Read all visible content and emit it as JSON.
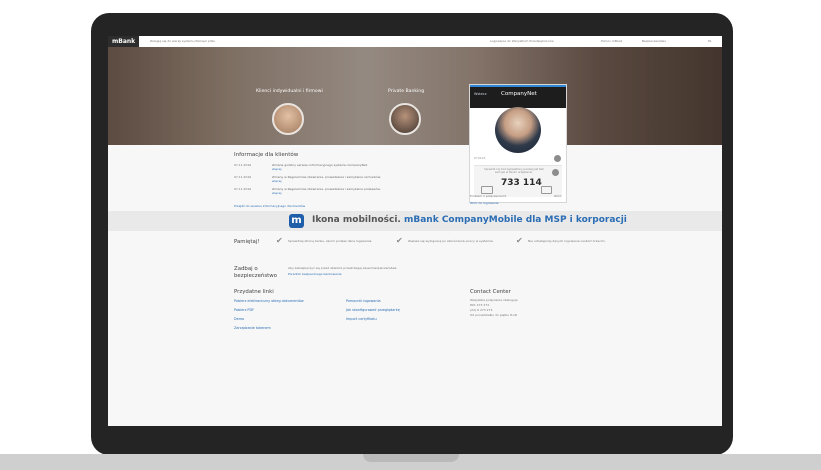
{
  "header": {
    "logo": "mBank",
    "notice": "Zaloguj się do wersji systemu Pamięci pliku",
    "right_links": [
      "Logowanie do Wszystkich Przedsiębiorców",
      "Pomoc mBank",
      "Bezpieczeństwo",
      "PL"
    ]
  },
  "hero": {
    "left_title": "Klienci indywidualni i firmowi",
    "mid_title": "Private Banking"
  },
  "login_card": {
    "back_label": "Wstecz",
    "title": "CompanyNet",
    "id_label": "670143",
    "instructions": "Sprawdź czy kod wyświetlony poniżej jest taki sam jak w Twoim urządzeniu.",
    "code": "733 114",
    "footer_left": "Problem z połączeniem?",
    "footer_right": "Wróć",
    "footer_link": "Wróć do logowania"
  },
  "info": {
    "title": "Informacje dla klientów",
    "rows": [
      {
        "date": "07.11.2016",
        "text": "Zmiana godziny serwisu informacyjnego systemu CompanyNet.",
        "link": "więcej"
      },
      {
        "date": "07.11.2016",
        "text": "Zmiany w Regulaminie otwierania, prowadzenia i zamykania rachunków.",
        "link": "więcej"
      },
      {
        "date": "07.11.2016",
        "text": "Zmiany w Regulaminie otwierania, prowadzenia i zamykania przelewów.",
        "link": "więcej"
      }
    ],
    "more_link": "Przejdź do serwisu informacyjnego dla klientów"
  },
  "banner": {
    "icon_letter": "m",
    "lead": "Ikona mobilności. ",
    "highlight": "mBank CompanyMobile dla MSP i korporacji"
  },
  "remember": {
    "title": "Pamiętaj!",
    "items": [
      "Sprawdzaj stronę banku, zanim podasz dane logowania.",
      "Zawsze się wylogowuj po zakończeniu pracy w systemie.",
      "Nie udostępniaj danych logowania osobom trzecim."
    ]
  },
  "security": {
    "title": "Zadbaj o bezpieczeństwo",
    "text": "Aby zabezpieczyć się przed atakami przestrzegaj zasad bezpieczeństwa.",
    "link": "Poradnik bezpiecznego bankowania"
  },
  "useful": {
    "title": "Przydatne linki",
    "col1": [
      "Pobierz elektroniczny obieg dokumentów",
      "Pobierz PDF",
      "Demo",
      "Zarządzanie tokenem"
    ],
    "col2": [
      "Pomocnik logowania",
      "Jak skonfigurować przeglądarkę",
      "Import certyfikatu"
    ]
  },
  "contact": {
    "title": "Contact Center",
    "lines": [
      "Wszystkie połączenia obsługuje",
      "801 273 273",
      "(22) 6 273 273",
      "Od poniedziałku do piątku 8-18"
    ]
  }
}
